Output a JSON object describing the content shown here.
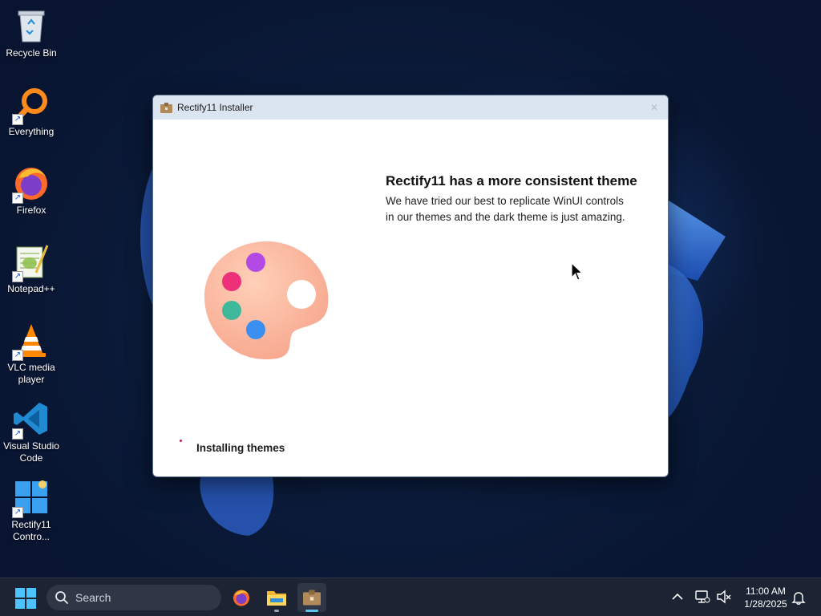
{
  "desktop": {
    "icons": [
      {
        "label": "Recycle Bin",
        "icon": "recycle-bin-icon"
      },
      {
        "label": "Everything",
        "icon": "everything-search-icon"
      },
      {
        "label": "Firefox",
        "icon": "firefox-icon"
      },
      {
        "label": "Notepad++",
        "icon": "notepad-plus-plus-icon"
      },
      {
        "label": "VLC media player",
        "icon": "vlc-icon"
      },
      {
        "label": "Visual Studio Code",
        "icon": "vscode-icon"
      },
      {
        "label": "Rectify11 Contro...",
        "icon": "rectify11-control-center-icon"
      }
    ]
  },
  "window": {
    "title": "Rectify11 Installer",
    "close_glyph": "✕",
    "heading": "Rectify11 has a more consistent theme",
    "description": "We have tried our best to replicate WinUI controls in our themes and the dark theme is just amazing.",
    "status": "Installing themes"
  },
  "taskbar": {
    "search_placeholder": "Search",
    "apps": [
      "firefox-icon",
      "file-explorer-icon",
      "rectify11-installer-icon"
    ],
    "clock_time": "11:00 AM",
    "clock_date": "1/28/2025"
  },
  "colors": {
    "taskbar_bg": "#1c2433",
    "titlebar_bg": "#dbe5f1",
    "accent": "#60c4f0"
  }
}
